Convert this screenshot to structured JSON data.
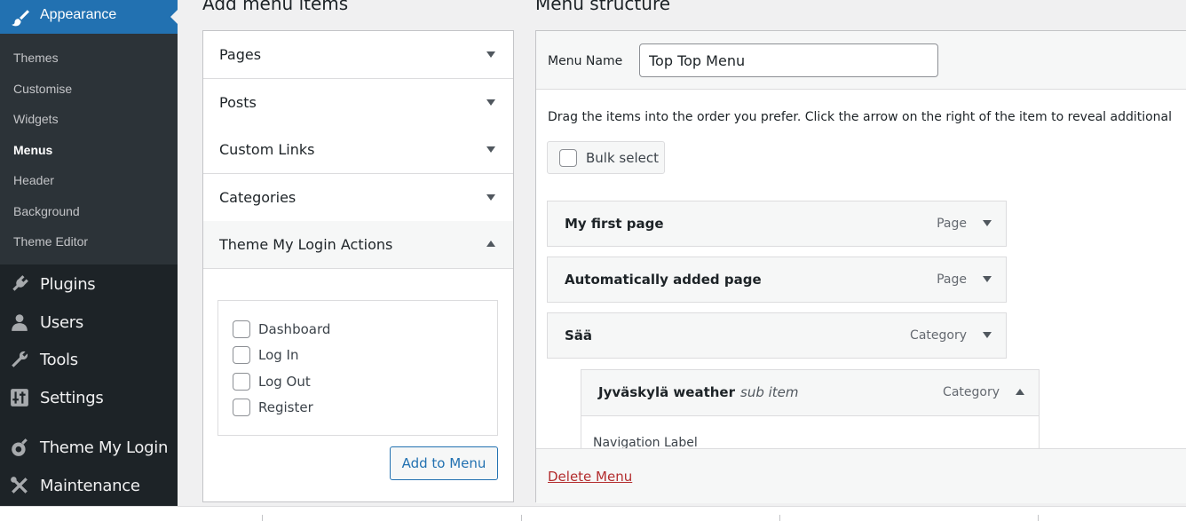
{
  "sidebar": {
    "active_menu": "Appearance",
    "submenu": [
      "Themes",
      "Customise",
      "Widgets",
      "Menus",
      "Header",
      "Background",
      "Theme Editor"
    ],
    "current_submenu": "Menus",
    "menu_items": [
      "Plugins",
      "Users",
      "Tools",
      "Settings",
      "Theme My Login",
      "Maintenance"
    ]
  },
  "add_items": {
    "title": "Add menu items",
    "sections": [
      "Pages",
      "Posts",
      "Custom Links",
      "Categories",
      "Theme My Login Actions"
    ],
    "tml_options": [
      "Dashboard",
      "Log In",
      "Log Out",
      "Register"
    ],
    "add_button": "Add to Menu"
  },
  "structure": {
    "title": "Menu structure",
    "menu_name_label": "Menu Name",
    "menu_name_value": "Top Top Menu",
    "instructions": "Drag the items into the order you prefer. Click the arrow on the right of the item to reveal additional",
    "bulk_select": "Bulk select",
    "items": [
      {
        "title": "My first page",
        "type": "Page",
        "sub": ""
      },
      {
        "title": "Automatically added page",
        "type": "Page",
        "sub": ""
      },
      {
        "title": "Sää",
        "type": "Category",
        "sub": ""
      },
      {
        "title": "Jyväskylä weather",
        "type": "Category",
        "sub": "sub item"
      }
    ],
    "nav_label": "Navigation Label",
    "delete_menu": "Delete Menu"
  },
  "colors": {
    "admin_bar": "#1d2327",
    "accent": "#2271b1",
    "delete": "#b32d2e"
  }
}
